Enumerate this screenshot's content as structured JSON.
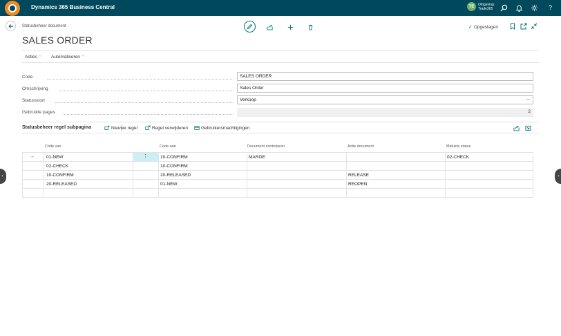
{
  "topbar": {
    "app_title": "Dynamics 365 Business Central",
    "env_badge": "TE",
    "env_line1": "Omgeving:",
    "env_line2": "Trade365",
    "colors": {
      "bar": "#00485b",
      "logo": "#f08a24"
    }
  },
  "header": {
    "breadcrumb": "Statusbeheer document",
    "title": "SALES ORDER",
    "saved_label": "Opgeslagen"
  },
  "menu": {
    "items": [
      {
        "label": "Acties"
      },
      {
        "label": "Automatiseren"
      }
    ]
  },
  "fields": {
    "code": {
      "label": "Code",
      "value": "SALES ORDER"
    },
    "description": {
      "label": "Omschrijving",
      "value": "Sales Order"
    },
    "status_type": {
      "label": "Statussoort",
      "value": "Verkoop"
    },
    "used_pages": {
      "label": "Gebruikte pages",
      "value": "2"
    }
  },
  "subpage": {
    "title": "Statusbeheer regel subpagina",
    "actions": {
      "new_line": "Nieuwe regel",
      "delete_line": "Regel verwijderen",
      "permissions": "Gebruikersmachtigingen"
    },
    "columns": {
      "code_from": "Code van",
      "code_to": "Code aan",
      "check_doc": "Document controleren",
      "action_doc": "Actie document",
      "intermediate": "Midukte status"
    },
    "rows": [
      {
        "code_from": "01-NEW",
        "code_to": "10-CONFIRM",
        "check_doc": "MARGE",
        "action_doc": "",
        "intermediate": "02-CHECK"
      },
      {
        "code_from": "02-CHECK",
        "code_to": "10-CONFIRM",
        "check_doc": "",
        "action_doc": "",
        "intermediate": ""
      },
      {
        "code_from": "10-CONFIRM",
        "code_to": "20-RELEASED",
        "check_doc": "",
        "action_doc": "RELEASE",
        "intermediate": ""
      },
      {
        "code_from": "20-RELEASED",
        "code_to": "01-NEW",
        "check_doc": "",
        "action_doc": "REOPEN",
        "intermediate": ""
      },
      {
        "code_from": "",
        "code_to": "",
        "check_doc": "",
        "action_doc": "",
        "intermediate": ""
      }
    ]
  },
  "accent_color": "#00757f"
}
